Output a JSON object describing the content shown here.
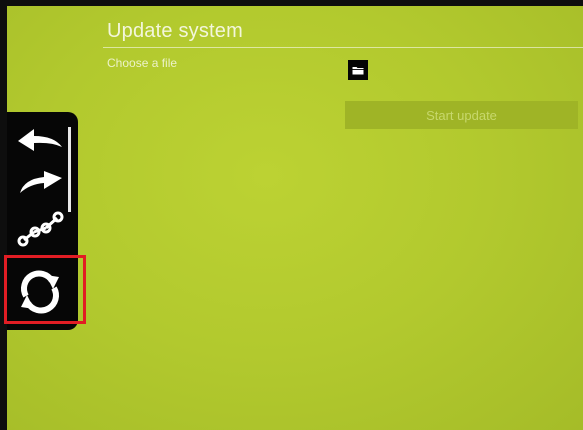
{
  "page": {
    "title": "Update system",
    "file_label": "Choose a file",
    "start_button_label": "Start update"
  },
  "icons": {
    "folder": "folder-icon",
    "back": "back-arrow-icon",
    "forward": "forward-arrow-icon",
    "network": "network-icon",
    "update": "refresh-icon"
  },
  "sidebar": {
    "items": [
      {
        "name": "back"
      },
      {
        "name": "forward"
      },
      {
        "name": "network"
      },
      {
        "name": "update",
        "selected": true
      }
    ]
  },
  "colors": {
    "background": "#b6cc30",
    "sidebar": "#060606",
    "highlight": "#e11d24",
    "disabled_button": "#9fb426"
  }
}
